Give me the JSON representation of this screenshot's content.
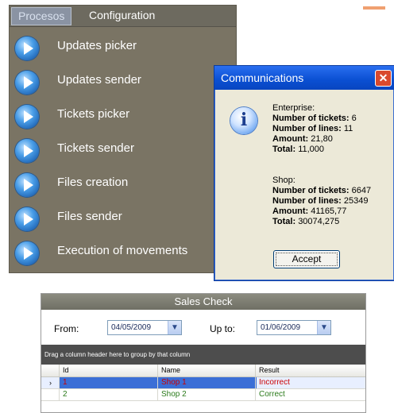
{
  "menu": {
    "tabs": [
      {
        "label": "Procesos",
        "active": true
      },
      {
        "label": "Configuration",
        "active": false
      }
    ],
    "items": [
      {
        "label": "Updates picker",
        "icon": "play-icon"
      },
      {
        "label": "Updates sender",
        "icon": "play-icon"
      },
      {
        "label": "Tickets picker",
        "icon": "play-icon"
      },
      {
        "label": "Tickets sender",
        "icon": "play-icon"
      },
      {
        "label": "Files creation",
        "icon": "play-icon"
      },
      {
        "label": "Files sender",
        "icon": "play-icon"
      },
      {
        "label": "Execution of movements",
        "icon": "play-icon"
      }
    ]
  },
  "dialog": {
    "title": "Communications",
    "close_glyph": "✕",
    "icon": "info-icon",
    "enterprise": {
      "header": "Enterprise:",
      "tickets_label": "Number of tickets:",
      "tickets_value": "6",
      "lines_label": "Number of lines:",
      "lines_value": "11",
      "amount_label": "Amount:",
      "amount_value": "21,80",
      "total_label": "Total:",
      "total_value": "11,000"
    },
    "shop": {
      "header": "Shop:",
      "tickets_label": "Number of tickets:",
      "tickets_value": "6647",
      "lines_label": "Number of lines:",
      "lines_value": "25349",
      "amount_label": "Amount:",
      "amount_value": "41165,77",
      "total_label": "Total:",
      "total_value": "30074,275"
    },
    "accept_label": "Accept"
  },
  "sales": {
    "title": "Sales Check",
    "from_label": "From:",
    "from_value": "04/05/2009",
    "upto_label": "Up to:",
    "upto_value": "01/06/2009",
    "group_hint": "Drag a column header here to group by that column",
    "columns": [
      "Id",
      "Name",
      "Result"
    ],
    "rows": [
      {
        "id": "1",
        "name": "Shop 1",
        "result": "Incorrect",
        "result_color": "#cc0000",
        "name_color": "#cc0000",
        "selected": true
      },
      {
        "id": "2",
        "name": "Shop 2",
        "result": "Correct",
        "result_color": "#2a7a1a",
        "name_color": "#2a7a1a",
        "selected": false
      }
    ],
    "row_indicator": "›"
  },
  "colors": {
    "menu_bg": "#7a7464",
    "dialog_title": "#0a4fd2",
    "incorrect": "#cc0000",
    "correct": "#2a7a1a"
  }
}
